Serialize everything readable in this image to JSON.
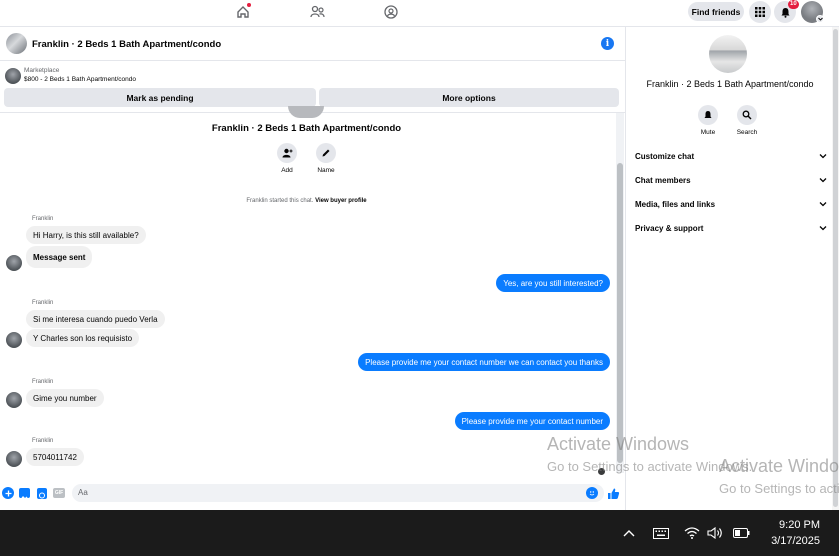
{
  "nav": {
    "find_friends": "Find friends",
    "notifications_badge": "10"
  },
  "chat_header": {
    "title": "Franklin · 2 Beds 1 Bath Apartment/condo"
  },
  "listing": {
    "source": "Marketplace",
    "summary": "$800 - 2 Beds 1 Bath Apartment/condo"
  },
  "actions": {
    "mark_pending": "Mark as pending",
    "more_options": "More options"
  },
  "intro": {
    "title": "Franklin · 2 Beds 1 Bath Apartment/condo",
    "add_label": "Add",
    "name_label": "Name",
    "started_text": "Franklin started this chat.",
    "view_profile": "View buyer profile"
  },
  "messages": {
    "sender": "Franklin",
    "m1": "Hi Harry, is this still available?",
    "m2": "Message sent",
    "m3": "Yes, are you still interested?",
    "m4": "Si me interesa cuando puedo Verla",
    "m5": "Y Charles son los requisisto",
    "m6": "Please provide me your contact number we can contact you  thanks",
    "m7": "Gime you number",
    "m8": "Please provide me your contact number",
    "m9": "5704011742"
  },
  "composer": {
    "placeholder": "Aa"
  },
  "info_panel": {
    "title": "Franklin · 2 Beds 1 Bath Apartment/condo",
    "mute": "Mute",
    "search": "Search",
    "menu": [
      "Customize chat",
      "Chat members",
      "Media, files and links",
      "Privacy & support"
    ]
  },
  "watermark": {
    "line1": "Activate Windows",
    "line2": "Go to Settings to activate Windows."
  },
  "taskbar": {
    "time": "9:20 PM",
    "date": "3/17/2025"
  },
  "colors": {
    "accent": "#0a7cff",
    "badge": "#e41e3f",
    "info_icon": "#1877f2"
  }
}
